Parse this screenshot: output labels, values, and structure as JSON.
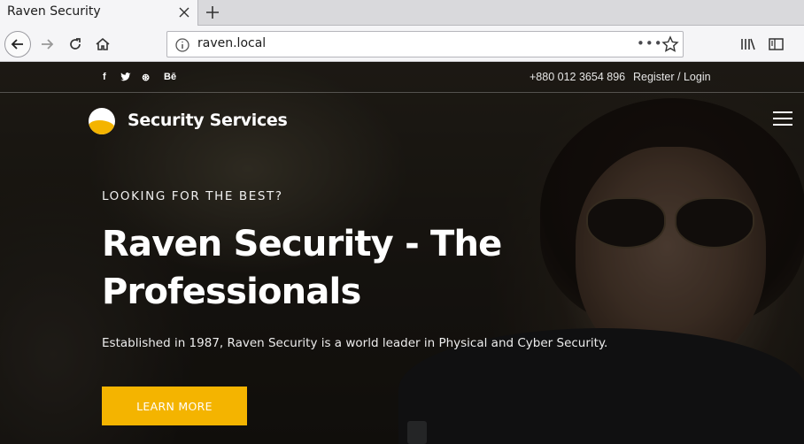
{
  "browser": {
    "tab_title": "Raven Security",
    "url": "raven.local",
    "url_more": "•••"
  },
  "topbar": {
    "social": {
      "facebook": "f",
      "twitter": "t",
      "dribbble": "⊛",
      "behance": "Bē"
    },
    "phone": "+880 012 3654 896",
    "login": "Register / Login"
  },
  "brand": {
    "name": "Security Services",
    "accent": "#f4b400"
  },
  "hero": {
    "kicker": "LOOKING FOR THE BEST?",
    "headline": "Raven Security - The Professionals",
    "lede": "Established in 1987, Raven Security is a world leader in Physical and Cyber Security.",
    "cta": "LEARN MORE"
  }
}
